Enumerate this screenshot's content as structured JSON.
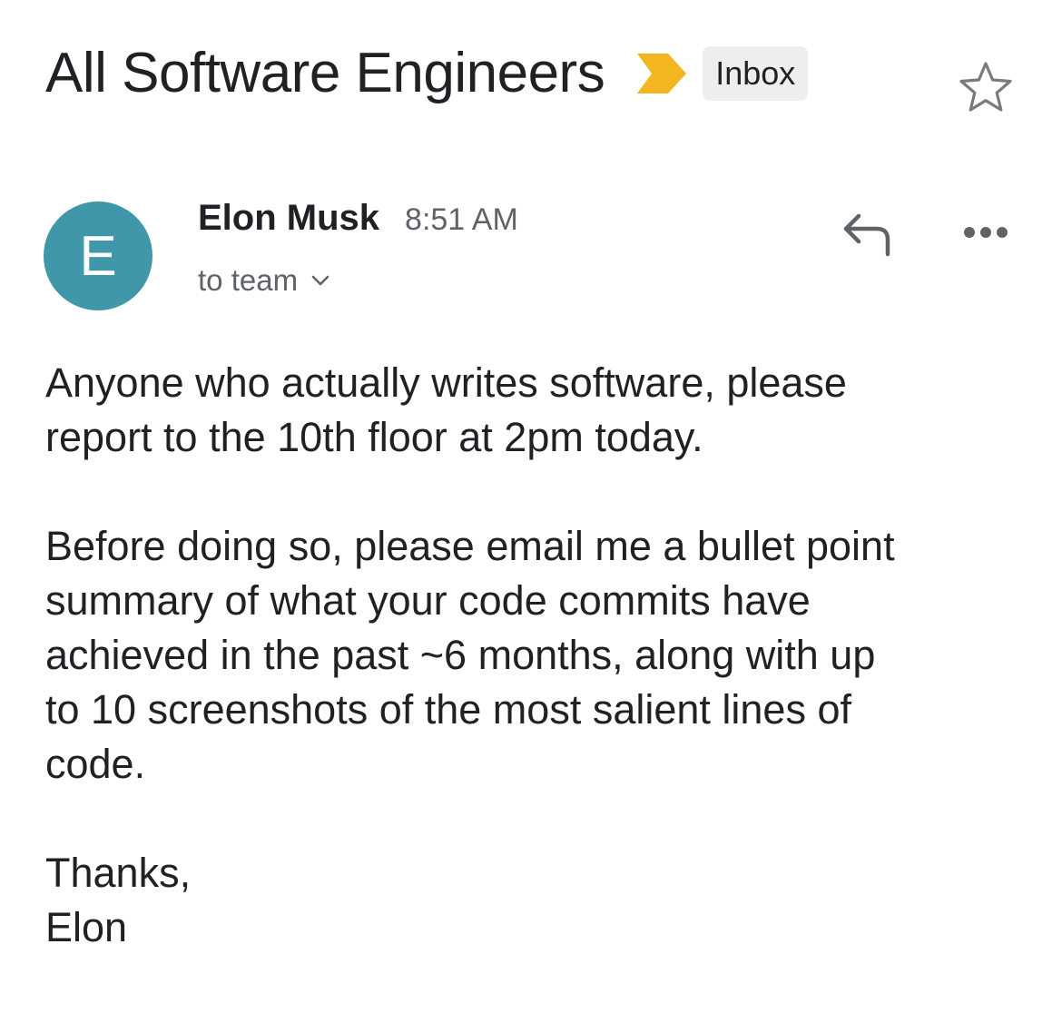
{
  "email": {
    "subject": "All Software Engineers",
    "label": "Inbox",
    "sender": {
      "initial": "E",
      "name": "Elon Musk",
      "time": "8:51 AM",
      "recipients": "to team"
    },
    "body": {
      "paragraph_1": [
        "Anyone who actually writes software, please",
        "report to the 10th floor at 2pm today."
      ],
      "paragraph_2": [
        "Before doing so, please email me a bullet point",
        "summary of what your code commits have",
        "achieved in the past ~6 months, along with up",
        "to 10 screenshots of the most salient lines of",
        "code."
      ],
      "signoff": "Thanks,",
      "signature": "Elon"
    }
  },
  "icons": {
    "importance": "importance-marker-icon",
    "star": "star-icon",
    "reply": "reply-icon",
    "more": "more-options-icon",
    "expand_recipients": "chevron-down-icon"
  },
  "colors": {
    "avatar_background": "#4097a9",
    "importance_marker": "#f2b720",
    "label_chip_background": "#eeeeee",
    "secondary_text": "#5f6368",
    "primary_text": "#202124"
  }
}
